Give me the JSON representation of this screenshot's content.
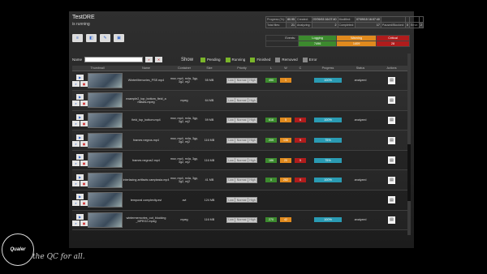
{
  "app": {
    "title": "TestDRE",
    "subtitle": "is running"
  },
  "toolbar": [
    {
      "icon": "menu-icon",
      "symbol": "≡"
    },
    {
      "icon": "layers-icon",
      "symbol": "◧"
    },
    {
      "icon": "edit-icon",
      "symbol": "✎"
    },
    {
      "icon": "pdf-icon",
      "symbol": "▣"
    }
  ],
  "stats": {
    "row1": [
      [
        "Progress (%):",
        "80.95"
      ],
      [
        "Created:",
        "07/09/15 16:07:40"
      ],
      [
        "Modified:",
        "07/09/15 16:07:40"
      ]
    ],
    "row2": [
      [
        "Total files:",
        "21"
      ],
      [
        "Analyzing:",
        "2"
      ],
      [
        "Completed:",
        "17"
      ],
      [
        "Paused/Blocked:",
        "0"
      ],
      [
        "Error:",
        "2"
      ]
    ]
  },
  "events": {
    "label": "Events:",
    "cols": [
      {
        "name": "Logging",
        "value": "7496",
        "color": "#3c8a2e"
      },
      {
        "name": "Warning",
        "value": "1409",
        "color": "#e08a1e"
      },
      {
        "name": "Critical",
        "value": "28",
        "color": "#b01c1c"
      }
    ]
  },
  "filter": {
    "name_label": "Name",
    "show_label": "Show",
    "options": [
      {
        "label": "Pending",
        "color": "#7ab52a"
      },
      {
        "label": "Running",
        "color": "#7ab52a"
      },
      {
        "label": "Finished",
        "color": "#7ab52a"
      },
      {
        "label": "Removed",
        "color": "#888888"
      },
      {
        "label": "Error",
        "color": "#888888"
      }
    ]
  },
  "columns": [
    "Thumbnail",
    "Name",
    "Container",
    "Size",
    "Priority",
    "L",
    "W",
    "C",
    "Progress",
    "Status",
    "Actions"
  ],
  "priority_labels": [
    "Low",
    "Normal",
    "High"
  ],
  "rows": [
    {
      "name": "WinterMemories_PSE.mp4",
      "container": "mov, mp4, m4a, 3gp, 3g2, mj2",
      "size": "55 MB",
      "l": "490",
      "w": "1",
      "c": "",
      "progress": "100%",
      "status": "analyzed"
    },
    {
      "name": "example2_top_bottom_field_a rtifacts.mpeg",
      "container": "mpeg",
      "size": "64 MB",
      "l": "",
      "w": "",
      "c": "",
      "progress": "",
      "status": ""
    },
    {
      "name": "field_top_bottom.mp4",
      "container": "mov, mp4, m4a, 3gp, 3g2, mj2",
      "size": "59 MB",
      "l": "616",
      "w": "5",
      "c": "6",
      "progress": "100%",
      "status": "analyzed"
    },
    {
      "name": "frames negros.mp4",
      "container": "mov, mp4, m4a, 3gp, 3g2, mj2",
      "size": "116 MB",
      "l": "209",
      "w": "136",
      "c": "5",
      "progress": "75%",
      "status": ""
    },
    {
      "name": "frames negros2.mp4",
      "container": "mov, mp4, m4a, 3gp, 3g2, mj2",
      "size": "116 MB",
      "l": "186",
      "w": "20",
      "c": "5",
      "progress": "75%",
      "status": ""
    },
    {
      "name": "interlacing artifacts camptasia.mp4",
      "container": "mov, mp4, m4a, 3gp, 3g2, mj2",
      "size": "41 MB",
      "l": "0",
      "w": "282",
      "c": "0",
      "progress": "100%",
      "status": "analyzed"
    },
    {
      "name": "temporal complexity.avi",
      "container": "avi",
      "size": "124 MB",
      "l": "",
      "w": "",
      "c": "",
      "progress": "",
      "status": ""
    },
    {
      "name": "wintermemories_out_blocking _MPEG2.mpeg",
      "container": "mpeg",
      "size": "116 MB",
      "l": "270",
      "w": "42",
      "c": "",
      "progress": "100%",
      "status": "analyzed"
    }
  ],
  "brand": {
    "logo": "Qualer",
    "tagline": "the QC for all."
  }
}
